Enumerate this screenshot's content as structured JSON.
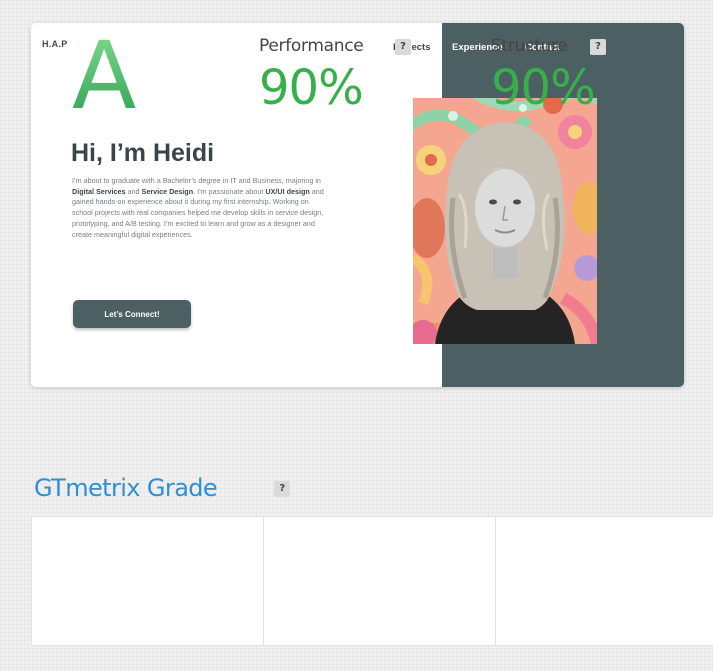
{
  "site": {
    "brand": "H.A.P",
    "nav": {
      "projects": "Projects",
      "experience": "Experience",
      "contact": "Contact"
    },
    "hero": {
      "title": "Hi, I’m Heidi",
      "bio": [
        {
          "t": "I’m about to graduate with a Bachelor’s degree in IT and Business, majoring in ",
          "b": false
        },
        {
          "t": "Digital Services",
          "b": true
        },
        {
          "t": " and ",
          "b": false
        },
        {
          "t": "Service Design",
          "b": true
        },
        {
          "t": ". I’m passionate about ",
          "b": false
        },
        {
          "t": "UX/UI design",
          "b": true
        },
        {
          "t": " and gained hands-on experience about it during my first internship. Working on school projects with real companies helped me develop skills in service design, prototyping, and A/B testing. I’m excited to learn and grow as a designer and create meaningful digital experiences.",
          "b": false
        }
      ],
      "cta_label": "Let’s Connect!"
    },
    "colors": {
      "dark_panel": "#4c5f63",
      "heading": "#394548"
    }
  },
  "gtmetrix": {
    "heading": "GTmetrix Grade",
    "help_glyph": "?",
    "grade": "A",
    "performance": {
      "label": "Performance",
      "value": "90%"
    },
    "structure": {
      "label": "Structure",
      "value": "90%"
    },
    "colors": {
      "heading": "#2f8fd2",
      "grade_green": "#38b049"
    }
  }
}
